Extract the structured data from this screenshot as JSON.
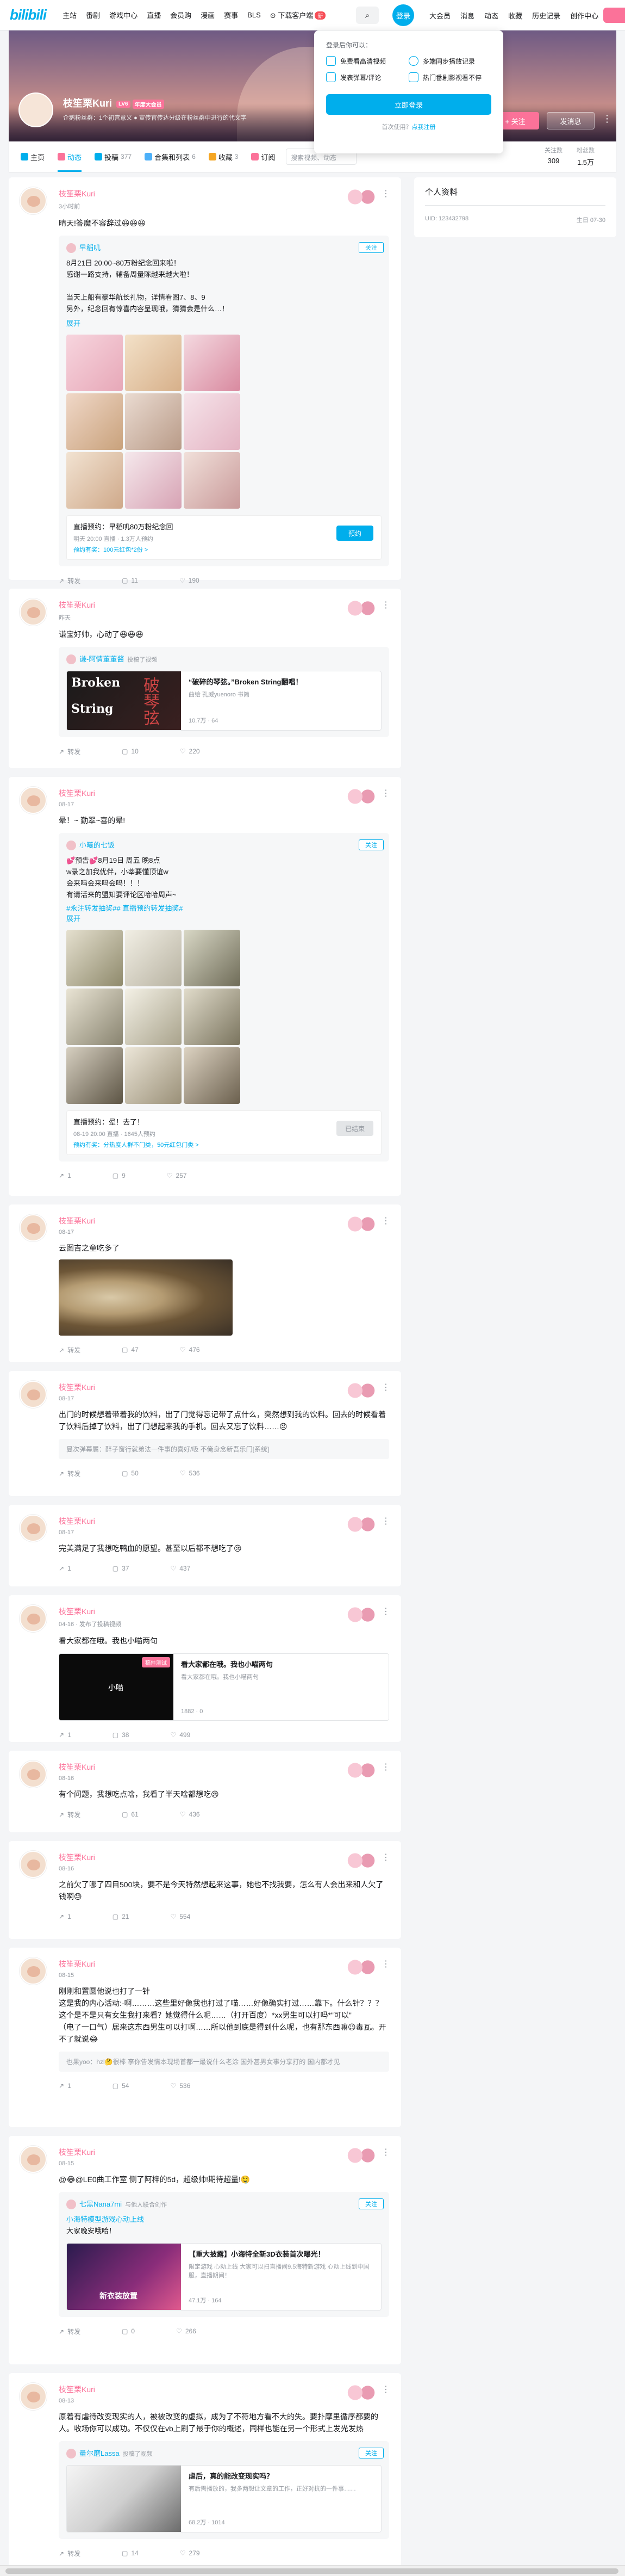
{
  "header": {
    "logo": "bilibili",
    "nav": [
      "主站",
      "番剧",
      "游戏中心",
      "直播",
      "会员购",
      "漫画",
      "赛事",
      "BLS"
    ],
    "download": "下载客户端",
    "download_badge": "新",
    "login": "登录",
    "right_nav": [
      "大会员",
      "消息",
      "动态",
      "收藏",
      "历史记录",
      "创作中心"
    ]
  },
  "login_popup": {
    "title": "登录后你可以：",
    "benefits": [
      "免费看高清视频",
      "多端同步播放记录",
      "发表弹幕/评论",
      "热门番剧影视看不停"
    ],
    "button": "立即登录",
    "first_use": "首次使用？",
    "register": "点我注册"
  },
  "profile": {
    "name": "枝笙栗Kuri",
    "level": "LV6",
    "vip": "年度大会员",
    "sign": "企鹅粉丝群：1个初宫意义 ● 宣传官传达分级在粉丝群中进行的代文字",
    "follow": "+ 关注",
    "message": "发消息",
    "more": "⋮"
  },
  "tabs": [
    {
      "label": "主页",
      "count": "",
      "color": "#00aeec"
    },
    {
      "label": "动态",
      "count": "",
      "color": "#fb7299"
    },
    {
      "label": "投稿",
      "count": "377",
      "color": "#00aeec"
    },
    {
      "label": "合集和列表",
      "count": "6",
      "color": "#4cb0f9"
    },
    {
      "label": "收藏",
      "count": "3",
      "color": "#f5a623"
    },
    {
      "label": "订阅",
      "count": "",
      "color": "#fb7299"
    }
  ],
  "tab_search_placeholder": "搜索视频、动态",
  "stats": [
    {
      "label": "关注数",
      "value": "309"
    },
    {
      "label": "粉丝数",
      "value": "1.5万"
    }
  ],
  "sidebar": {
    "title": "个人资料",
    "uid": "UID: 123432798",
    "birthday": "生日 07-30"
  },
  "posts": [
    {
      "name": "枝笙栗Kuri",
      "time": "3小时前",
      "text": "晴天!答魔不容辞过😆😆😆",
      "sub": {
        "name": "早稻叽",
        "follow": "关注",
        "text": "8月21日 20:00~80万粉纪念回来啦！\n感谢一路支持，辅备周量陈越来越大啦！\n\n当天上船有豪华航长礼物，详情看图7、8、9\n另外，纪念回有惊喜内容呈现哦，猜猜会是什么…！",
        "expand": "展开",
        "reserve_title": "直播预约：早稻叽80万粉纪念回",
        "reserve_sub": "明天 20:00 直播 · 1.3万人预约",
        "reserve_award": "预约有奖：100元红包*2份 >",
        "reserve_btn": "预约"
      },
      "forward": "转发",
      "comment": "11",
      "like": "190"
    },
    {
      "name": "枝笙栗Kuri",
      "time": "昨天",
      "text": "谦宝好帅，心动了😆😆😆",
      "sub": {
        "name": "谦-阿情董董酱",
        "tag": "投稿了视频",
        "video_title": "“破碎的琴弦。”Broken String翻唱！",
        "video_desc": "曲绘 孔威yuenoro 书简",
        "video_stat": "10.7万 · 64",
        "video_dur": "",
        "thumb_a": "Broken",
        "thumb_b": "String",
        "thumb_c": "破琴弦"
      },
      "forward": "转发",
      "comment": "10",
      "like": "220"
    },
    {
      "name": "枝笙栗Kuri",
      "time": "08-17",
      "text": "晕！~ 勤翠~喜的晕!",
      "sub": {
        "name": "小曦的七饭",
        "follow": "关注",
        "text": "💕预告💕8月19日 周五 晚8点\nw录之加我优伴，小莘要懂顶谊w\n会来吗会来吗会吗！！！\n有请活来的盟知要评论区哈哈周声~",
        "tags": "#永注转发抽奖## 直播预约转发抽奖#",
        "expand": "展开",
        "reserve_title": "直播预约：晕！去了！",
        "reserve_sub": "08-19 20:00 直播 · 1645人预约",
        "reserve_award": "预约有奖：分热度人群不门类，50元红包门类 >",
        "reserve_btn": "已结束"
      },
      "forward": "1",
      "comment": "9",
      "like": "257"
    },
    {
      "name": "枝笙栗Kuri",
      "time": "08-17",
      "text": "云图吉之童吃多了",
      "forward": "转发",
      "comment": "47",
      "like": "476"
    },
    {
      "name": "枝笙栗Kuri",
      "time": "08-17",
      "text": "出门的时候想着带着我的饮料，出了门觉得忘记带了点什么，突然想到我的饮料。回去的时候看着了饮料后掉了饮料，出了门想起来我的手机。回去又忘了饮料……😣",
      "quote": "曼次弹幕属：醉子窗行就弟法一件事的喜好/吸 不俺身念新吾乐门[系统]",
      "forward": "转发",
      "comment": "50",
      "like": "536"
    },
    {
      "name": "枝笙栗Kuri",
      "time": "08-17",
      "text": "完美满足了我想吃鸭血的愿望。甚至以后都不想吃了😢",
      "forward": "1",
      "comment": "37",
      "like": "437"
    },
    {
      "name": "枝笙栗Kuri",
      "time": "04-16 · 发布了投稿视频",
      "text": "看大家都在哦。我也小喵两句",
      "sub": {
        "video_title": "看大家都在哦。我也小喵两句",
        "video_desc": "看大家都在哦。我也小喵两句",
        "video_stat": "1882 · 0",
        "video_dur": "",
        "thumb_a": "小喵",
        "thumb_badge": "稿件测试"
      },
      "forward": "1",
      "comment": "38",
      "like": "499"
    },
    {
      "name": "枝笙栗Kuri",
      "time": "08-16",
      "text": "有个问题，我想吃点啥，我看了半天啥都想吃😢",
      "forward": "转发",
      "comment": "61",
      "like": "436"
    },
    {
      "name": "枝笙栗Kuri",
      "time": "08-16",
      "text": "之前欠了哪了四目500块，要不是今天特然想起来这事，她也不找我要，怎么有人会出来和人欠了钱啊😓",
      "forward": "1",
      "comment": "21",
      "like": "554"
    },
    {
      "name": "枝笙栗Kuri",
      "time": "08-15",
      "text": "刚刚和置圆他说也打了一针\n这是我的内心活动:-啊………这些里好像我也打过了喵……好像确实打过……靠下。什么针？？？这个是不是只有女生我打来看？她觉得什么呢……（打开百度）*xx男生可以打吗*\"可以\"\n（电了一口气）居来这东西男生可以打啊……所以他到底是得到什么呢，也有那东西嘛😉毒瓦。开不了就说😂",
      "quote": "也果yoo：hzl🤔很棒 李你告发情本现场首都一最说什么老涂 国外甚男女事分享打的 国内都才见",
      "forward": "1",
      "comment": "54",
      "like": "536"
    },
    {
      "name": "枝笙栗Kuri",
      "time": "08-15",
      "text": "@😂@LE0曲工作室 侧了阿梓的5d，超级帅!期待超量!🤤",
      "sub": {
        "name": "七黑Nana7mi",
        "tag": "与他人联合创作",
        "follow": "关注",
        "link": "小海特模型游戏心动上线",
        "text2": "大家晚安哦哈！",
        "video_title": "【重大披露】小海特全新3D衣装首次曝光！",
        "video_desc": "限定游戏 心动上线 大家可以扫直播间9.5海特新游戏 心动上线到中国服，直播期间！",
        "video_stat": "47.1万 · 164",
        "video_dur": "",
        "thumb_a": "新衣装放置"
      },
      "forward": "转发",
      "comment": "0",
      "like": "266"
    },
    {
      "name": "枝笙栗Kuri",
      "time": "08-13",
      "text": "原着有虐待改变现实的人，被被改变的虚拟，成为了不符地方看不大的失。要扑摩里循序都要的人。收场你可以成功。不仅仅在vb上刷了最于你的概述，同样也能在另一个形式上发光发热",
      "sub": {
        "name": "量尔磨Lassa",
        "tag": "投稿了视频",
        "follow": "关注",
        "video_title": "虐后，真的能改变现实吗？",
        "video_desc": "有后需播放的，我多两想让文章的工作，正好对抗的一件事……",
        "video_stat": "68.2万 · 1014",
        "video_dur": ""
      },
      "forward": "转发",
      "comment": "14",
      "like": "279"
    }
  ]
}
